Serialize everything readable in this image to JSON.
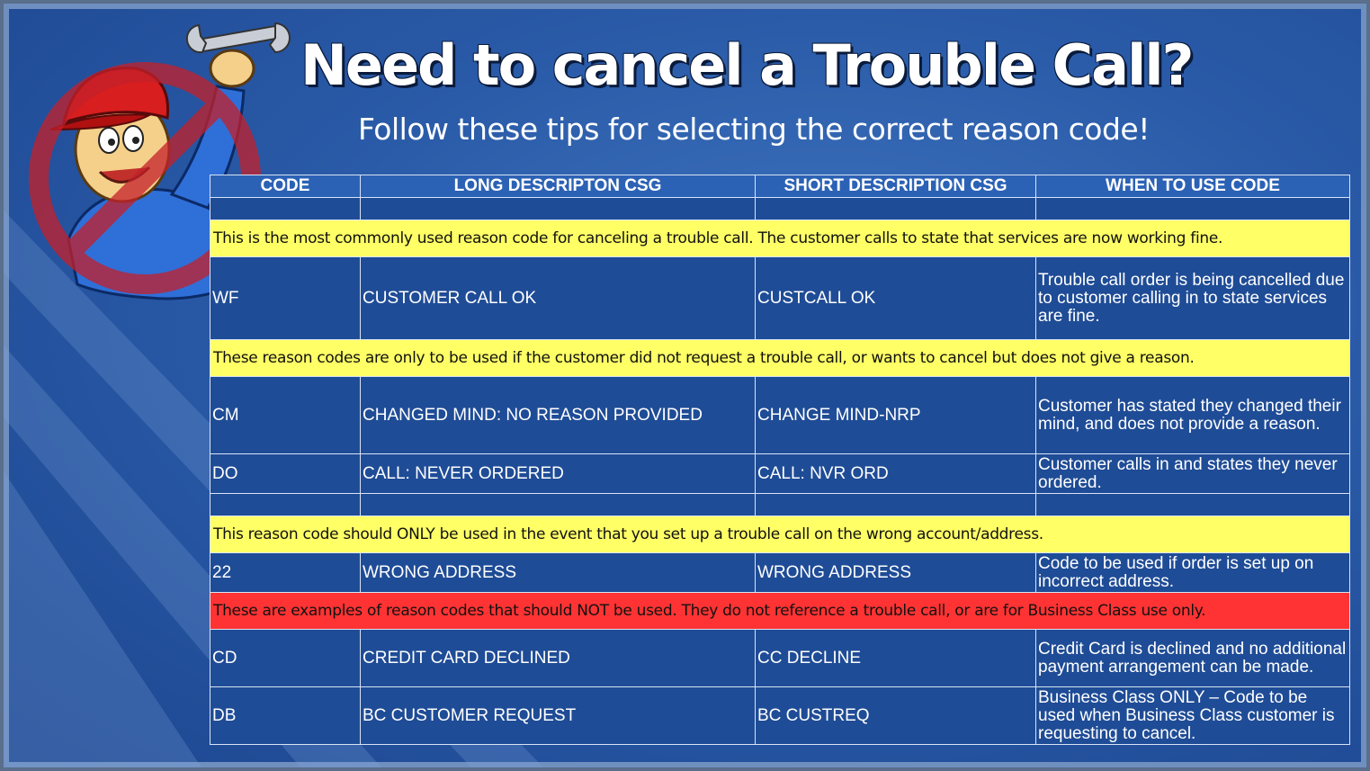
{
  "header": {
    "title": "Need to cancel a Trouble Call?",
    "subtitle": "Follow these tips for selecting the correct reason code!"
  },
  "table": {
    "columns": [
      "CODE",
      "LONG DESCRIPTON CSG",
      "SHORT DESCRIPTION CSG",
      "WHEN TO USE CODE"
    ],
    "note_common": "This is the most commonly used reason code for canceling a trouble call. The customer calls to state that services are now working fine.",
    "row_wf": {
      "code": "WF",
      "long": "CUSTOMER CALL OK",
      "short": "CUSTCALL OK",
      "when": "Trouble call order is being cancelled due to customer calling in to state services are fine."
    },
    "note_no_reason": "These reason codes are only to be used if the customer did not request a trouble call, or wants to cancel but does not give a reason.",
    "row_cm": {
      "code": "CM",
      "long": "CHANGED MIND: NO REASON PROVIDED",
      "short": "CHANGE MIND-NRP",
      "when": "Customer has stated they changed their mind, and does not provide a reason."
    },
    "row_do": {
      "code": "DO",
      "long": "CALL: NEVER ORDERED",
      "short": "CALL: NVR ORD",
      "when": "Customer calls in and states they never ordered."
    },
    "note_wrong": "This reason code should ONLY be used in the event that you set up a trouble call on the wrong account/address.",
    "row_22": {
      "code": "22",
      "long": "WRONG ADDRESS",
      "short": "WRONG ADDRESS",
      "when": "Code to be used if order is set up on incorrect address."
    },
    "note_not_used": "These are examples of reason codes that should NOT be used. They do not reference a trouble call, or are for Business Class use only.",
    "row_cd": {
      "code": "CD",
      "long": "CREDIT CARD DECLINED",
      "short": "CC DECLINE",
      "when": "Credit Card is declined and no additional payment arrangement can be made."
    },
    "row_db": {
      "code": "DB",
      "long": "BC CUSTOMER REQUEST",
      "short": "BC CUSTREQ",
      "when": "Business Class ONLY – Code to be used when Business Class customer is requesting to cancel."
    }
  },
  "colors": {
    "note_yellow": "#ffff66",
    "note_red": "#ff3333",
    "table_blue": "#1f4c96"
  },
  "icons": [
    "repairman-mascot-icon",
    "no-prohibition-icon",
    "wrench-icon"
  ]
}
